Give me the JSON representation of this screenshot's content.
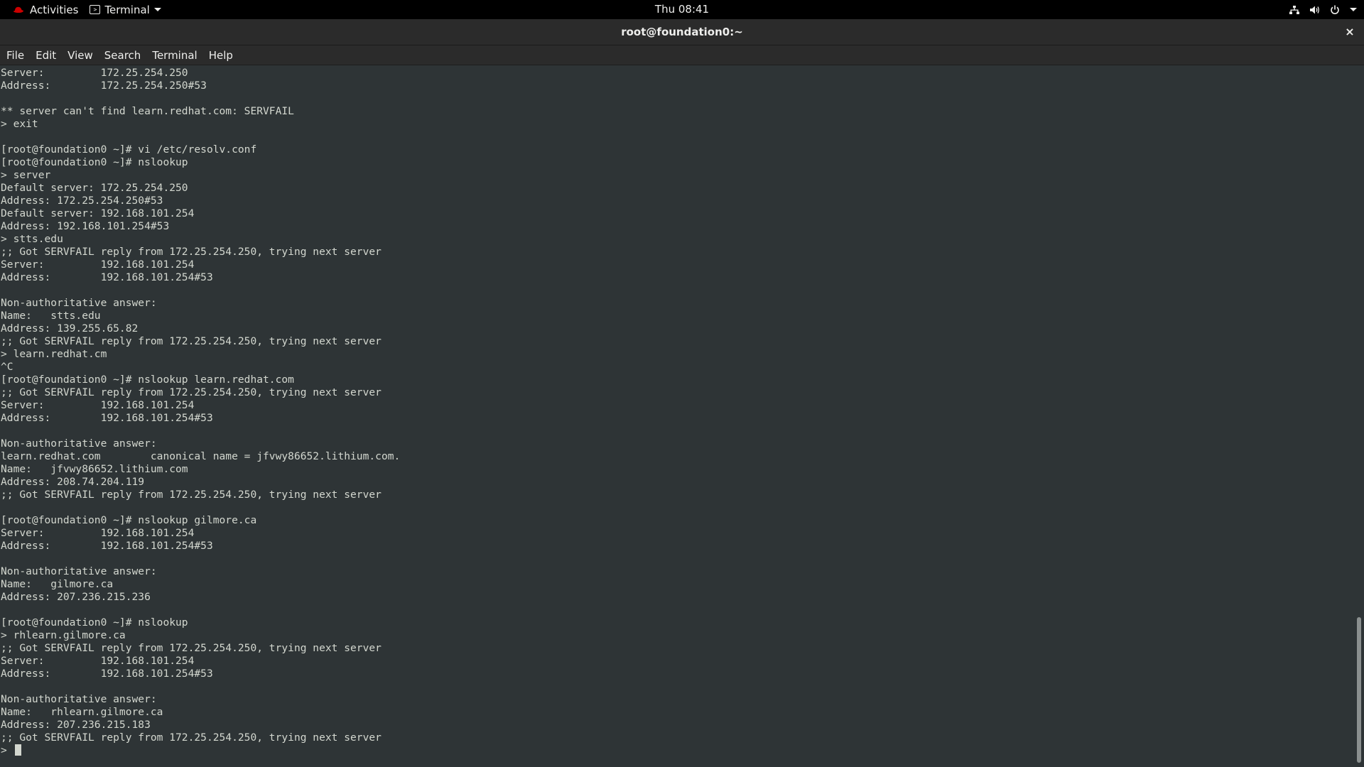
{
  "topbar": {
    "activities_label": "Activities",
    "app_menu_label": "Terminal",
    "clock": "Thu 08:41",
    "icons": [
      "network-icon",
      "volume-icon",
      "power-icon",
      "chevron-down-icon"
    ]
  },
  "window": {
    "title": "root@foundation0:~",
    "close_label": "×"
  },
  "menubar": {
    "items": [
      "File",
      "Edit",
      "View",
      "Search",
      "Terminal",
      "Help"
    ]
  },
  "terminal": {
    "lines": [
      "Server:         172.25.254.250",
      "Address:        172.25.254.250#53",
      "",
      "** server can't find learn.redhat.com: SERVFAIL",
      "> exit",
      "",
      "[root@foundation0 ~]# vi /etc/resolv.conf",
      "[root@foundation0 ~]# nslookup",
      "> server",
      "Default server: 172.25.254.250",
      "Address: 172.25.254.250#53",
      "Default server: 192.168.101.254",
      "Address: 192.168.101.254#53",
      "> stts.edu",
      ";; Got SERVFAIL reply from 172.25.254.250, trying next server",
      "Server:         192.168.101.254",
      "Address:        192.168.101.254#53",
      "",
      "Non-authoritative answer:",
      "Name:   stts.edu",
      "Address: 139.255.65.82",
      ";; Got SERVFAIL reply from 172.25.254.250, trying next server",
      "> learn.redhat.cm",
      "^C",
      "[root@foundation0 ~]# nslookup learn.redhat.com",
      ";; Got SERVFAIL reply from 172.25.254.250, trying next server",
      "Server:         192.168.101.254",
      "Address:        192.168.101.254#53",
      "",
      "Non-authoritative answer:",
      "learn.redhat.com        canonical name = jfvwy86652.lithium.com.",
      "Name:   jfvwy86652.lithium.com",
      "Address: 208.74.204.119",
      ";; Got SERVFAIL reply from 172.25.254.250, trying next server",
      "",
      "[root@foundation0 ~]# nslookup gilmore.ca",
      "Server:         192.168.101.254",
      "Address:        192.168.101.254#53",
      "",
      "Non-authoritative answer:",
      "Name:   gilmore.ca",
      "Address: 207.236.215.236",
      "",
      "[root@foundation0 ~]# nslookup",
      "> rhlearn.gilmore.ca",
      ";; Got SERVFAIL reply from 172.25.254.250, trying next server",
      "Server:         192.168.101.254",
      "Address:        192.168.101.254#53",
      "",
      "Non-authoritative answer:",
      "Name:   rhlearn.gilmore.ca",
      "Address: 207.236.215.183",
      ";; Got SERVFAIL reply from 172.25.254.250, trying next server"
    ],
    "prompt": ">",
    "colors": {
      "background": "#2e3436",
      "foreground": "#d3d7cf"
    }
  }
}
